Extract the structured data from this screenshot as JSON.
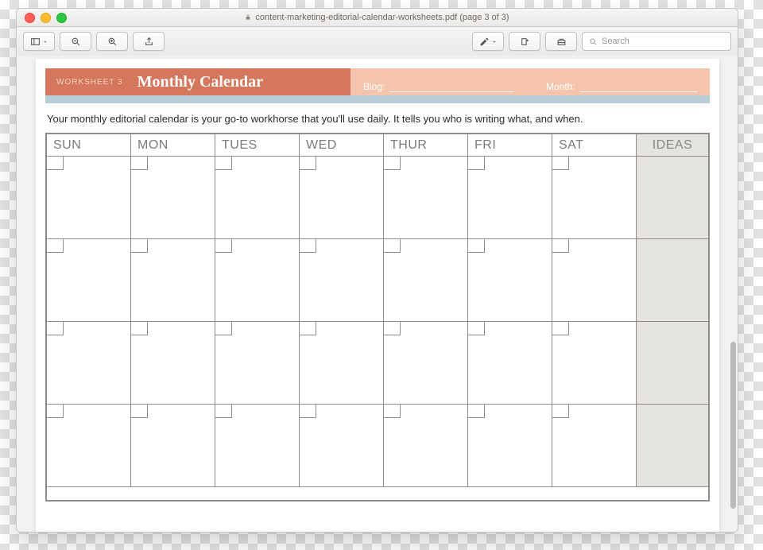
{
  "window": {
    "title": "content-marketing-editorial-calendar-worksheets.pdf (page 3 of 3)"
  },
  "toolbar": {
    "search_placeholder": "Search"
  },
  "document": {
    "worksheet_number": "WORKSHEET 3",
    "worksheet_title": "Monthly Calendar",
    "blog_label": "Blog:",
    "month_label": "Month:",
    "intro": "Your monthly editorial calendar is your go-to workhorse that you'll use daily. It tells you who is writing what, and when.",
    "days": [
      "SUN",
      "MON",
      "TUES",
      "WED",
      "THUR",
      "FRI",
      "SAT"
    ],
    "ideas_label": "IDEAS"
  }
}
